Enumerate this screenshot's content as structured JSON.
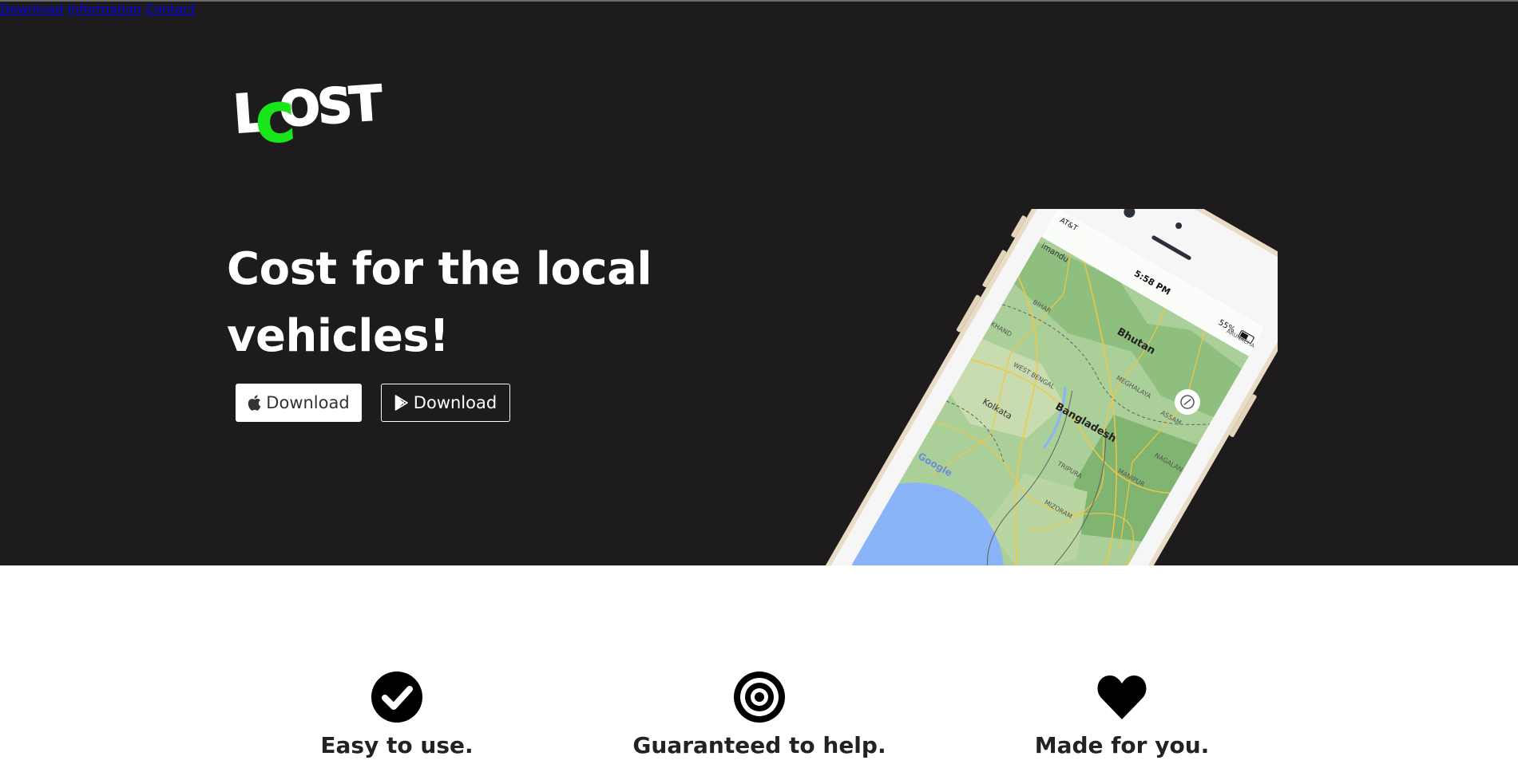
{
  "brand": {
    "logo_text": "LCOST",
    "accent_color": "#19e619"
  },
  "nav": {
    "items": [
      "Download",
      "Information",
      "Contact"
    ]
  },
  "hero": {
    "headline_line1": "Cost for the local",
    "headline_line2": "vehicles!",
    "buttons": [
      {
        "label": "Download",
        "icon": "apple-icon",
        "style": "filled"
      },
      {
        "label": "Download",
        "icon": "google-play-icon",
        "style": "outline"
      }
    ],
    "phone": {
      "carrier": "AT&T",
      "time": "5:58 PM",
      "battery": "55%",
      "map_labels": [
        "Bhutan",
        "Bangladesh",
        "Kolkata",
        "BIHAR",
        "KHAND",
        "WEST BENGAL",
        "MEGHALAYA",
        "ASSAM",
        "NAGALAND",
        "MANIPUR",
        "TRIPURA",
        "MIZORAM",
        "imandu",
        "ARUNACHAL"
      ],
      "map_brand": "Google"
    }
  },
  "features": [
    {
      "icon": "check-circle-icon",
      "title": "Easy to use."
    },
    {
      "icon": "target-icon",
      "title": "Guaranteed to help."
    },
    {
      "icon": "heart-icon",
      "title": "Made for you."
    }
  ],
  "colors": {
    "hero_bg": "#1d1b1c",
    "nav_text": "#9a9a9a",
    "feature_text": "#222222"
  }
}
